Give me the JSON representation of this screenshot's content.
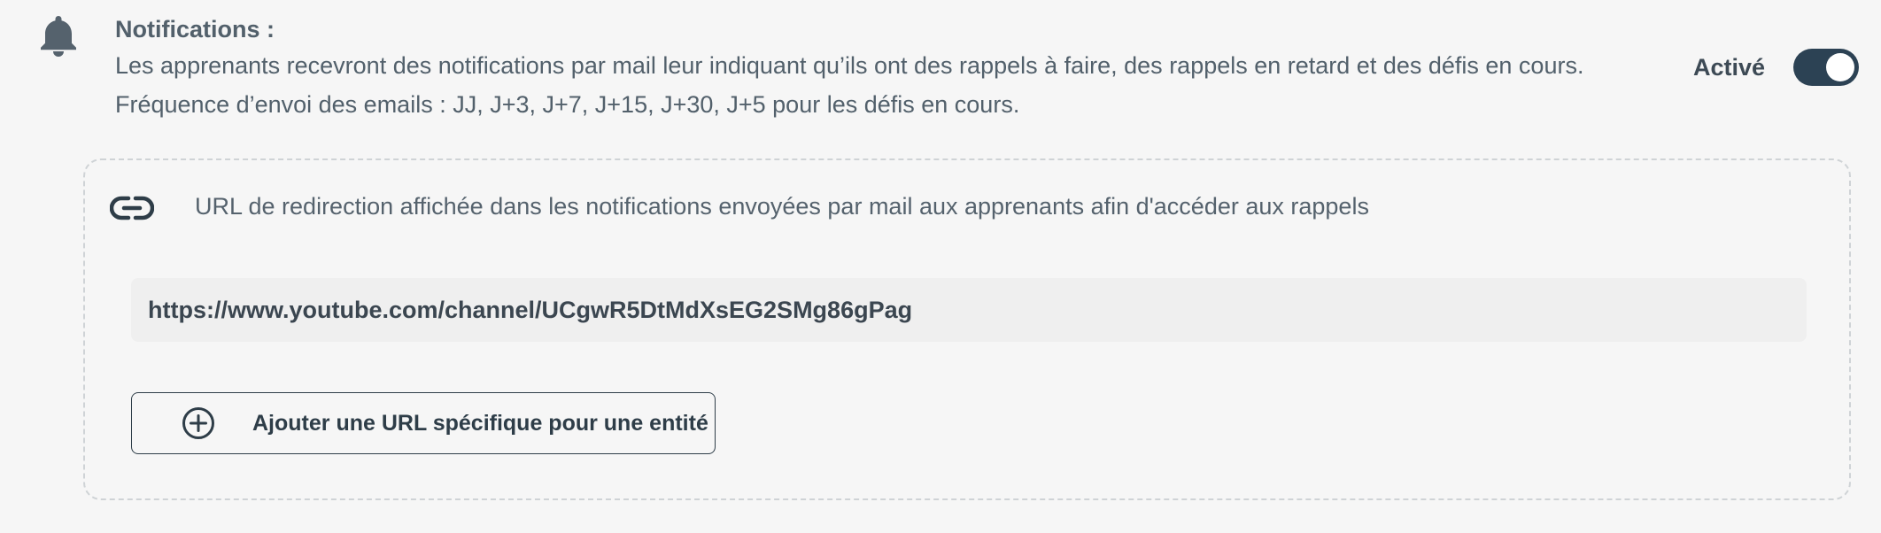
{
  "notifications": {
    "title": "Notifications :",
    "description": "Les apprenants recevront des notifications par mail leur indiquant qu’ils ont des rappels à faire, des rappels en retard et des défis en cours.",
    "frequency": "Fréquence d’envoi des emails : JJ, J+3, J+7, J+15, J+30, J+5 pour les défis en cours.",
    "status_label": "Activé",
    "enabled": true,
    "icon": "bell-icon"
  },
  "redirect": {
    "description": "URL de redirection affichée dans les notifications envoyées par mail aux apprenants afin d'accéder aux rappels",
    "url_value": "https://www.youtube.com/channel/UCgwR5DtMdXsEG2SMg86gPag",
    "icon": "link-icon",
    "add_button_label": "Ajouter une URL spécifique pour une entité",
    "add_button_icon": "plus-circle-icon"
  },
  "colors": {
    "background": "#f6f6f6",
    "toggle_on": "#2c4254",
    "text": "#52606b",
    "input_background": "#efefef",
    "border_dashed": "#cfd3d6"
  }
}
